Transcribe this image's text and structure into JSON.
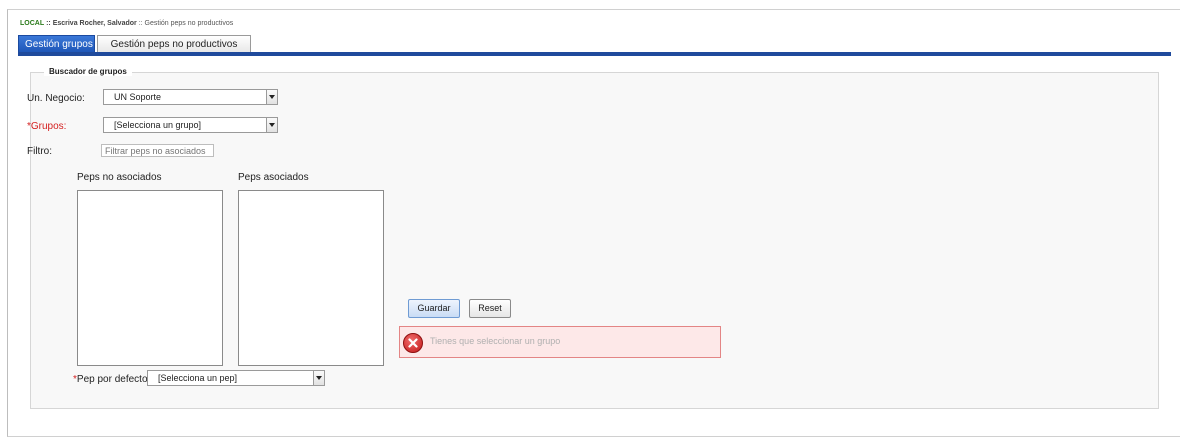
{
  "breadcrumb": {
    "env": "LOCAL",
    "user": "Escriva Rocher, Salvador",
    "page": "Gestión peps no productivos",
    "separator": "::"
  },
  "tabs": [
    {
      "label": "Gestión grupos",
      "active": true
    },
    {
      "label": "Gestión peps no productivos",
      "active": false
    }
  ],
  "section": {
    "legend": "Buscador de grupos"
  },
  "form": {
    "negocio_label": "Un. Negocio:",
    "negocio_value": "UN Soporte",
    "grupos_label": "*Grupos:",
    "grupos_value": "[Selecciona un grupo]",
    "filtro_label": "Filtro:",
    "filtro_placeholder": "Filtrar peps no asociados",
    "no_asociados_label": "Peps no asociados",
    "asociados_label": "Peps asociados",
    "pep_defecto_asterisk": "*",
    "pep_defecto_label": "Pep por defecto:",
    "pep_defecto_value": "[Selecciona un pep]"
  },
  "actions": {
    "save_label": "Guardar",
    "reset_label": "Reset"
  },
  "error": {
    "message": "Tienes que seleccionar un grupo",
    "icon": "error-x-icon"
  },
  "colors": {
    "accent": "#1f4a9c",
    "required": "#d42020",
    "env": "#2a7a1a",
    "error_bg": "#fde8e8"
  }
}
